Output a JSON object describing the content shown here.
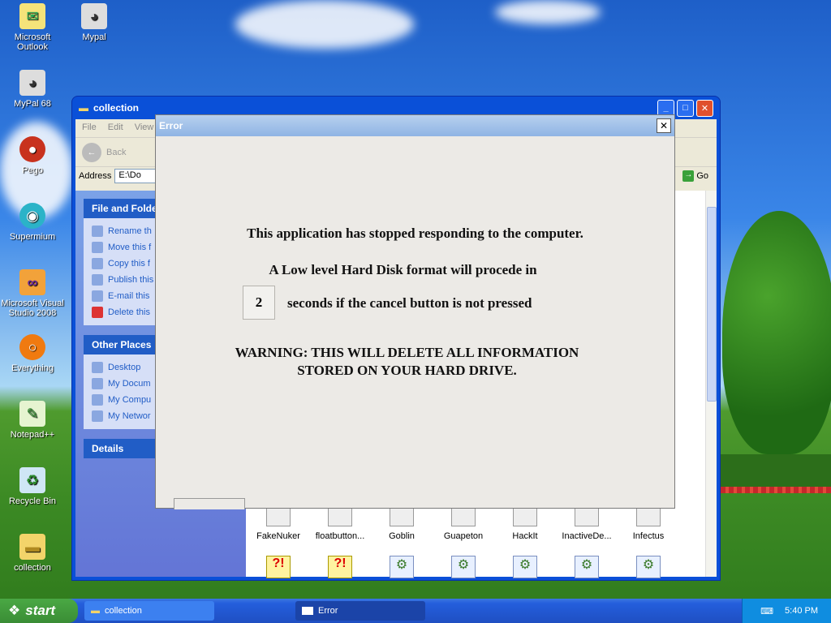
{
  "desktop": {
    "icons": [
      {
        "label": "Microsoft Outlook"
      },
      {
        "label": "Mypal"
      },
      {
        "label": "MyPal 68"
      },
      {
        "label": "Pego"
      },
      {
        "label": "Supermium"
      },
      {
        "label": "Microsoft Visual Studio 2008"
      },
      {
        "label": "Everything"
      },
      {
        "label": "Notepad++"
      },
      {
        "label": "Recycle Bin"
      },
      {
        "label": "collection"
      }
    ]
  },
  "explorer": {
    "title": "collection",
    "menu": [
      "File",
      "Edit",
      "View"
    ],
    "toolbar": {
      "back": "Back"
    },
    "address": {
      "label": "Address",
      "value": "E:\\Do",
      "go": "Go"
    },
    "file_tasks": {
      "heading": "File and Folde",
      "items": [
        "Rename th",
        "Move this f",
        "Copy this f",
        "Publish this",
        "E-mail this",
        "Delete this"
      ]
    },
    "other_places": {
      "heading": "Other Places",
      "items": [
        "Desktop",
        "My Docum",
        "My Compu",
        "My Networ"
      ]
    },
    "details": {
      "heading": "Details"
    },
    "files": [
      "FakeNuker",
      "floatbutton...",
      "Goblin",
      "Guapeton",
      "HackIt",
      "InactiveDe...",
      "Infectus"
    ]
  },
  "dialog": {
    "title": "Error",
    "line1": "This application has stopped responding to the computer.",
    "line2": "A Low level Hard Disk format will procede in",
    "countdown": "2",
    "line3": "seconds if the cancel button is not pressed",
    "warning1": "WARNING:  THIS WILL DELETE ALL INFORMATION",
    "warning2": "STORED ON YOUR HARD DRIVE."
  },
  "taskbar": {
    "start": "start",
    "tasks": [
      {
        "label": "collection"
      },
      {
        "label": "Error"
      }
    ],
    "clock": "5:40 PM"
  }
}
